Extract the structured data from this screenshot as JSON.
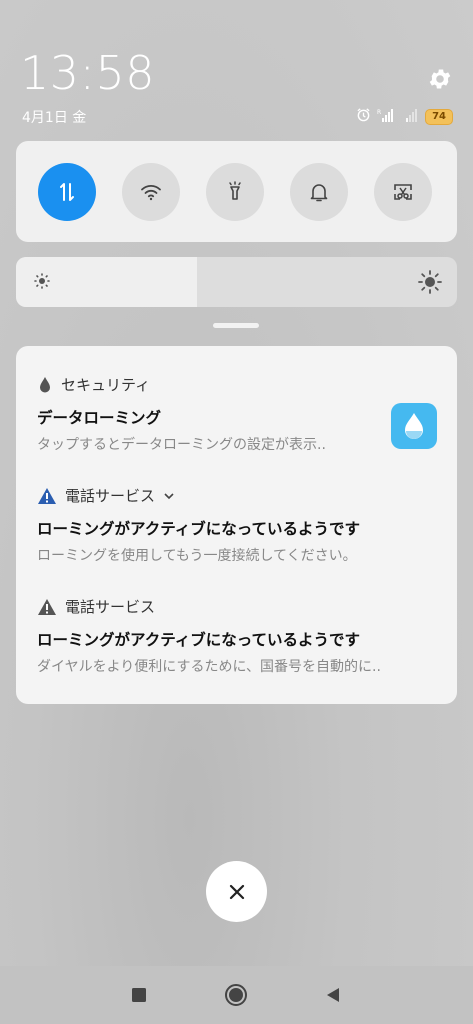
{
  "status": {
    "time": "13:58",
    "date": "4月1日 金",
    "battery": "74"
  },
  "icons": {
    "settings": "gear-icon",
    "alarm": "alarm-clock-icon",
    "signal_1": "signal-roaming-icon",
    "signal_2": "signal-weak-icon"
  },
  "quick_settings": [
    {
      "name": "mobile-data",
      "icon": "data-arrows-icon",
      "active": true
    },
    {
      "name": "wifi",
      "icon": "wifi-icon",
      "active": false
    },
    {
      "name": "flashlight",
      "icon": "flashlight-icon",
      "active": false
    },
    {
      "name": "ringer",
      "icon": "bell-icon",
      "active": false
    },
    {
      "name": "screenshot",
      "icon": "scissors-screenshot-icon",
      "active": false
    }
  ],
  "brightness": {
    "level": 0.41
  },
  "notifications": [
    {
      "app": "セキュリティ",
      "title": "データローミング",
      "body": "タップするとデータローミングの設定が表示..",
      "icon": "drop-icon"
    },
    {
      "app": "電話サービス",
      "title": "ローミングがアクティブになっているようです",
      "body": "ローミングを使用してもう一度接続してください。",
      "icon": "warning-blue-icon"
    },
    {
      "app": "電話サービス",
      "title": "ローミングがアクティブになっているようです",
      "body": "ダイヤルをより便利にするために、国番号を自動的に..",
      "icon": "warning-gray-icon"
    }
  ],
  "colors": {
    "accent": "#1a90f0",
    "app_thumb": "#45b9f0",
    "warning_blue": "#2a5db0",
    "battery": "#f3c15a"
  }
}
